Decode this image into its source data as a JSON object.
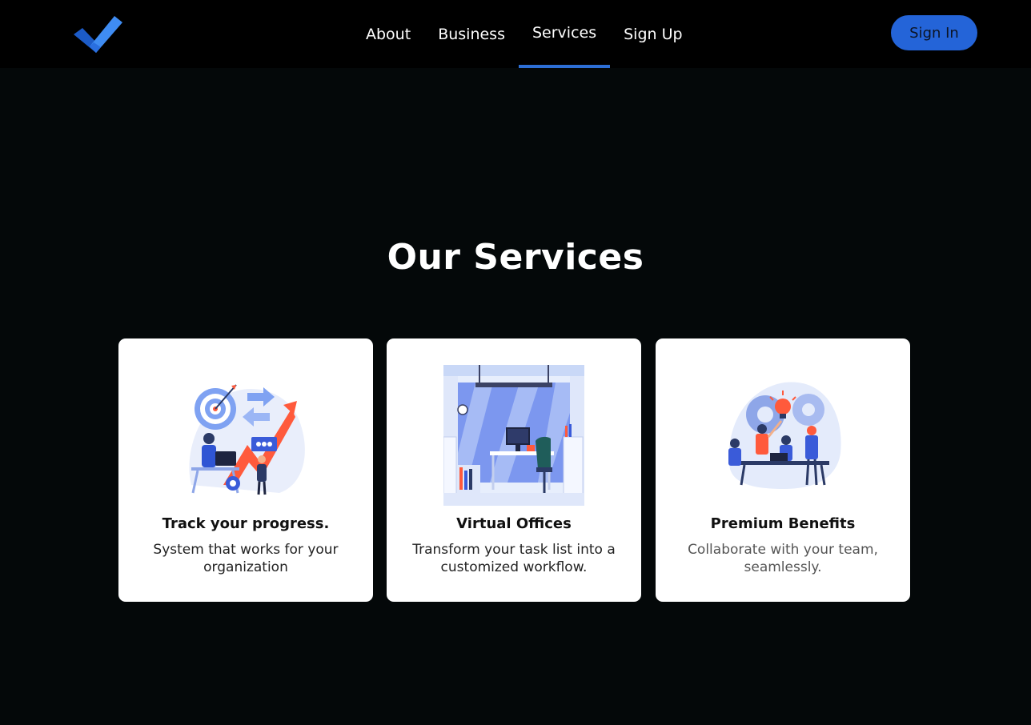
{
  "nav": {
    "logo_icon": "checkmark-logo-icon",
    "links": [
      {
        "label": "About"
      },
      {
        "label": "Business"
      },
      {
        "label": "Services"
      },
      {
        "label": "Sign Up"
      }
    ],
    "active": "Services",
    "signin_label": "Sign In"
  },
  "colors": {
    "accent": "#2464d8",
    "background": "#040809",
    "navbar": "#000000",
    "card": "#ffffff"
  },
  "services": {
    "title": "Our Services",
    "cards": [
      {
        "title": "Track your progress.",
        "description": "System that works for your organization",
        "illustration": "progress-tracking-illustration"
      },
      {
        "title": "Virtual Offices",
        "description": "Transform your task list into a customized workflow.",
        "illustration": "virtual-office-illustration"
      },
      {
        "title": "Premium Benefits",
        "description": "Collaborate with your team, seamlessly.",
        "illustration": "team-collaboration-illustration"
      }
    ]
  }
}
